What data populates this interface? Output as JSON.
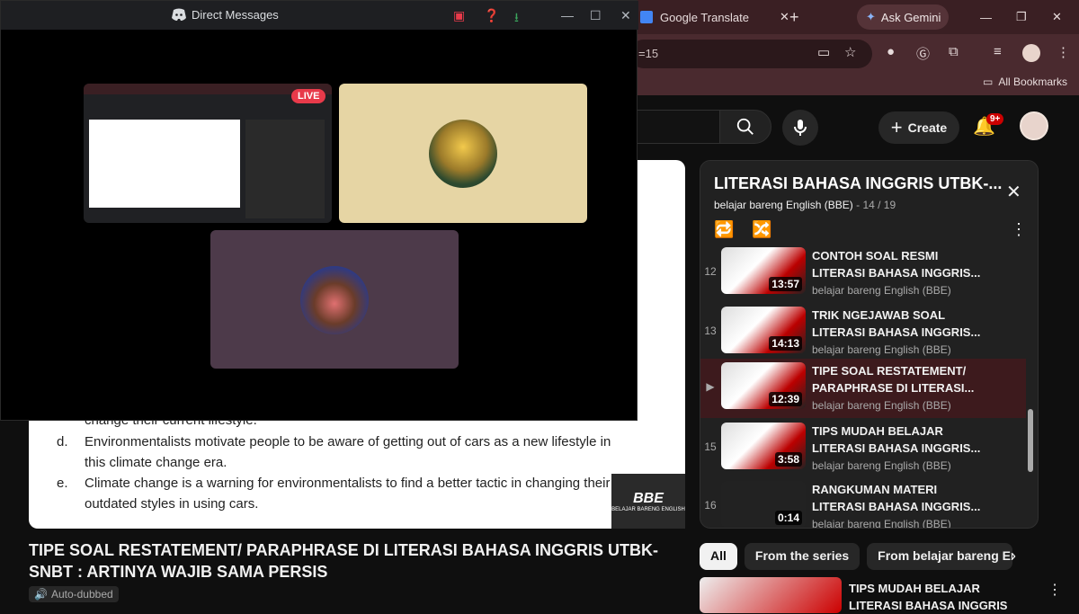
{
  "browser": {
    "tab_translate": "Google Translate",
    "ask_gemini": "Ask Gemini",
    "omnibox_text": "=15",
    "all_bookmarks": "All Bookmarks"
  },
  "youtube": {
    "create_label": "Create",
    "notif_badge": "9+",
    "video_title": "TIPE SOAL RESTATEMENT/ PARAPHRASE DI LITERASI BAHASA INGGRIS UTBK-SNBT : ARTINYA WAJIB SAMA PERSIS",
    "auto_dubbed": "Auto-dubbed",
    "doc_lines": [
      "change their current lifestyle.",
      "Environmentalists motivate people to be aware of getting out of cars as a new lifestyle in",
      "this climate change era.",
      "Climate change is a warning for environmentalists to find a better tactic in changing their",
      "outdated styles in using cars."
    ],
    "doc_markers": [
      "d.",
      "e."
    ],
    "bbe_logo": "BBE",
    "bbe_sub": "BELAJAR BARENG ENGLISH",
    "playlist": {
      "title": "LITERASI BAHASA INGGRIS UTBK-...",
      "channel": "belajar bareng English (BBE)",
      "position": "- 14 / 19",
      "items": [
        {
          "index": "12",
          "title": "CONTOH SOAL RESMI LITERASI BAHASA INGGRIS...",
          "channel": "belajar bareng English (BBE)",
          "duration": "13:57"
        },
        {
          "index": "13",
          "title": "TRIK NGEJAWAB SOAL LITERASI BAHASA INGGRIS...",
          "channel": "belajar bareng English (BBE)",
          "duration": "14:13"
        },
        {
          "index": "▶",
          "title": "TIPE SOAL RESTATEMENT/ PARAPHRASE DI LITERASI...",
          "channel": "belajar bareng English (BBE)",
          "duration": "12:39"
        },
        {
          "index": "15",
          "title": "TIPS MUDAH BELAJAR LITERASI BAHASA INGGRIS...",
          "channel": "belajar bareng English (BBE)",
          "duration": "3:58"
        },
        {
          "index": "16",
          "title": "RANGKUMAN MATERI LITERASI BAHASA INGGRIS...",
          "channel": "belajar bareng English (BBE)",
          "duration": "0:14"
        }
      ]
    },
    "chips": [
      "All",
      "From the series",
      "From belajar bareng Engli"
    ],
    "rec_title": "TIPS MUDAH BELAJAR LITERASI BAHASA INGGRIS"
  },
  "discord": {
    "window_title": "Direct Messages",
    "live_label": "LIVE"
  }
}
